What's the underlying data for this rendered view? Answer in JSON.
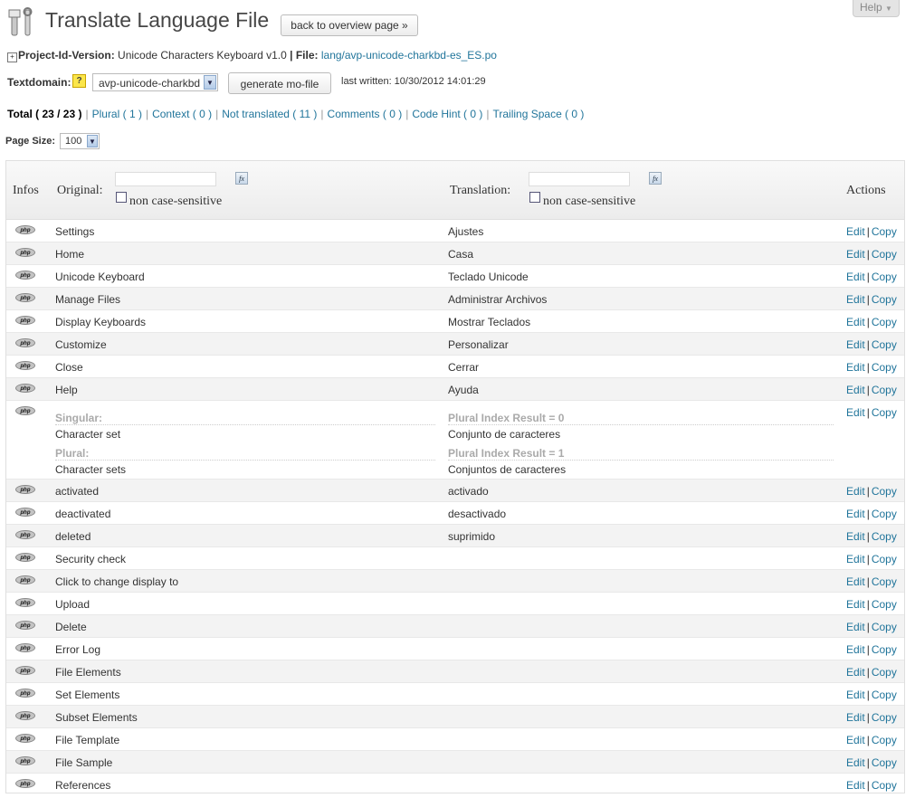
{
  "help": {
    "label": "Help"
  },
  "page": {
    "title": "Translate Language File",
    "back_label": "back to overview page »"
  },
  "project": {
    "id_label": "Project-Id-Version:",
    "id_value": "Unicode Characters Keyboard v1.0",
    "file_label": "| File:",
    "file_link": "lang/avp-unicode-charkbd-es_ES.po"
  },
  "textdomain": {
    "label": "Textdomain:",
    "help_icon": "?",
    "selected": "avp-unicode-charkbd",
    "generate_label": "generate mo-file",
    "last_written": "last written:  10/30/2012 14:01:29"
  },
  "filters": {
    "total": "Total ( 23 / 23 )",
    "plural": "Plural ( 1 )",
    "context": "Context ( 0 )",
    "not_translated": "Not translated ( 11 )",
    "comments": "Comments ( 0 )",
    "code_hint": "Code Hint ( 0 )",
    "trailing_space": "Trailing Space ( 0 )",
    "separator": "|"
  },
  "page_size": {
    "label": "Page Size:",
    "value": "100"
  },
  "table": {
    "headers": {
      "infos": "Infos",
      "original": "Original:",
      "translation": "Translation:",
      "actions": "Actions",
      "case_label": "non case-sensitive",
      "fx": "fx"
    },
    "php_badge": "php",
    "action_edit": "Edit",
    "action_copy": "Copy",
    "action_sep": "|",
    "rows": [
      {
        "original": "Settings",
        "translation": "Ajustes"
      },
      {
        "original": "Home",
        "translation": "Casa"
      },
      {
        "original": "Unicode Keyboard",
        "translation": "Teclado Unicode"
      },
      {
        "original": "Manage Files",
        "translation": "Administrar Archivos"
      },
      {
        "original": "Display Keyboards",
        "translation": "Mostrar Teclados"
      },
      {
        "original": "Customize",
        "translation": "Personalizar"
      },
      {
        "original": "Close",
        "translation": "Cerrar"
      },
      {
        "original": "Help",
        "translation": "Ayuda"
      }
    ],
    "plural_row": {
      "singular_label": "Singular:",
      "singular": "Character set",
      "plural_label": "Plural:",
      "plural": "Character sets",
      "index0_label": "Plural Index Result = 0",
      "index0": "Conjunto de caracteres",
      "index1_label": "Plural Index Result = 1",
      "index1": "Conjuntos de caracteres"
    },
    "rows2": [
      {
        "original": "activated",
        "translation": "activado"
      },
      {
        "original": "deactivated",
        "translation": "desactivado"
      },
      {
        "original": "deleted",
        "translation": "suprimido"
      },
      {
        "original": "Security check",
        "translation": ""
      },
      {
        "original": "Click to change display to",
        "translation": ""
      },
      {
        "original": "Upload",
        "translation": ""
      },
      {
        "original": "Delete",
        "translation": ""
      },
      {
        "original": "Error Log",
        "translation": ""
      },
      {
        "original": "File Elements",
        "translation": ""
      },
      {
        "original": "Set Elements",
        "translation": ""
      },
      {
        "original": "Subset Elements",
        "translation": ""
      },
      {
        "original": "File Template",
        "translation": ""
      },
      {
        "original": "File Sample",
        "translation": ""
      },
      {
        "original": "References",
        "translation": ""
      }
    ]
  }
}
